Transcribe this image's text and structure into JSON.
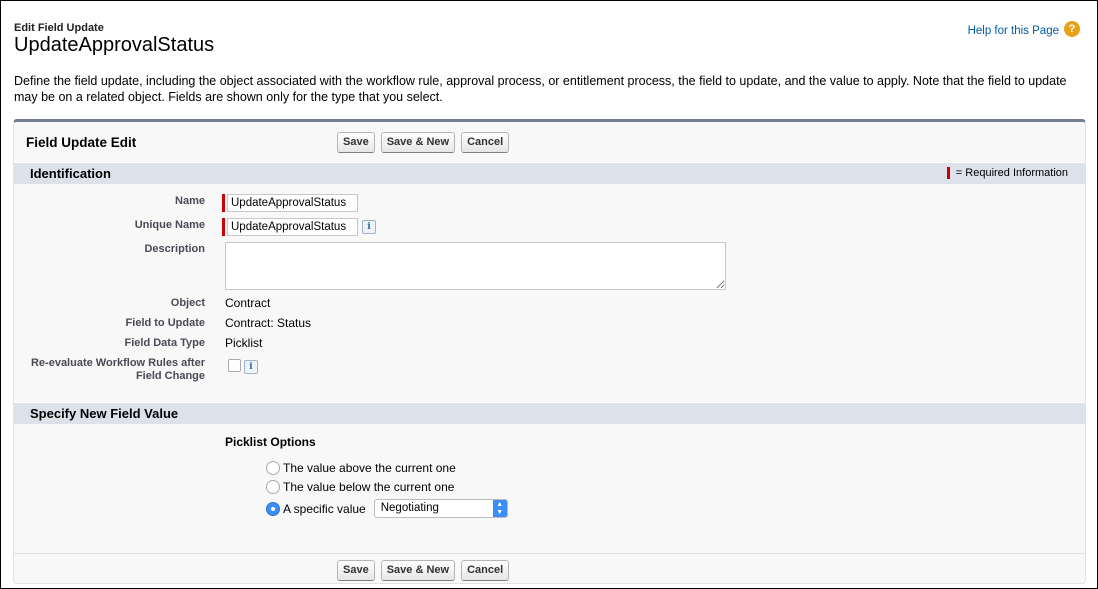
{
  "header": {
    "breadcrumb": "Edit Field Update",
    "title": "UpdateApprovalStatus",
    "help_link": "Help for this Page",
    "help_icon": "?"
  },
  "description": "Define the field update, including the object associated with the workflow rule, approval process, or entitlement process, the field to update, and the value to apply. Note that the field to update may be on a related object. Fields are shown only for the type that you select.",
  "panel": {
    "title": "Field Update Edit",
    "buttons": {
      "save": "Save",
      "save_new": "Save & New",
      "cancel": "Cancel"
    }
  },
  "identification": {
    "title": "Identification",
    "required_legend": "= Required Information",
    "fields": {
      "name_label": "Name",
      "name_value": "UpdateApprovalStatus",
      "unique_name_label": "Unique Name",
      "unique_name_value": "UpdateApprovalStatus",
      "description_label": "Description",
      "description_value": "",
      "object_label": "Object",
      "object_value": "Contract",
      "field_to_update_label": "Field to Update",
      "field_to_update_value": "Contract: Status",
      "field_data_type_label": "Field Data Type",
      "field_data_type_value": "Picklist",
      "reevaluate_label_1": "Re-evaluate Workflow Rules after",
      "reevaluate_label_2": "Field Change",
      "reevaluate_checked": false
    },
    "info_icon": "i"
  },
  "new_value": {
    "title": "Specify New Field Value",
    "picklist_label": "Picklist Options",
    "options": [
      {
        "label": "The value above the current one",
        "checked": false
      },
      {
        "label": "The value below the current one",
        "checked": false
      },
      {
        "label": "A specific value",
        "checked": true
      }
    ],
    "selected_value": "Negotiating"
  },
  "colors": {
    "required": "#cc0000",
    "link": "#015ba7",
    "section_header": "#dde1ea",
    "radio_selected": "#3a8ef5"
  }
}
